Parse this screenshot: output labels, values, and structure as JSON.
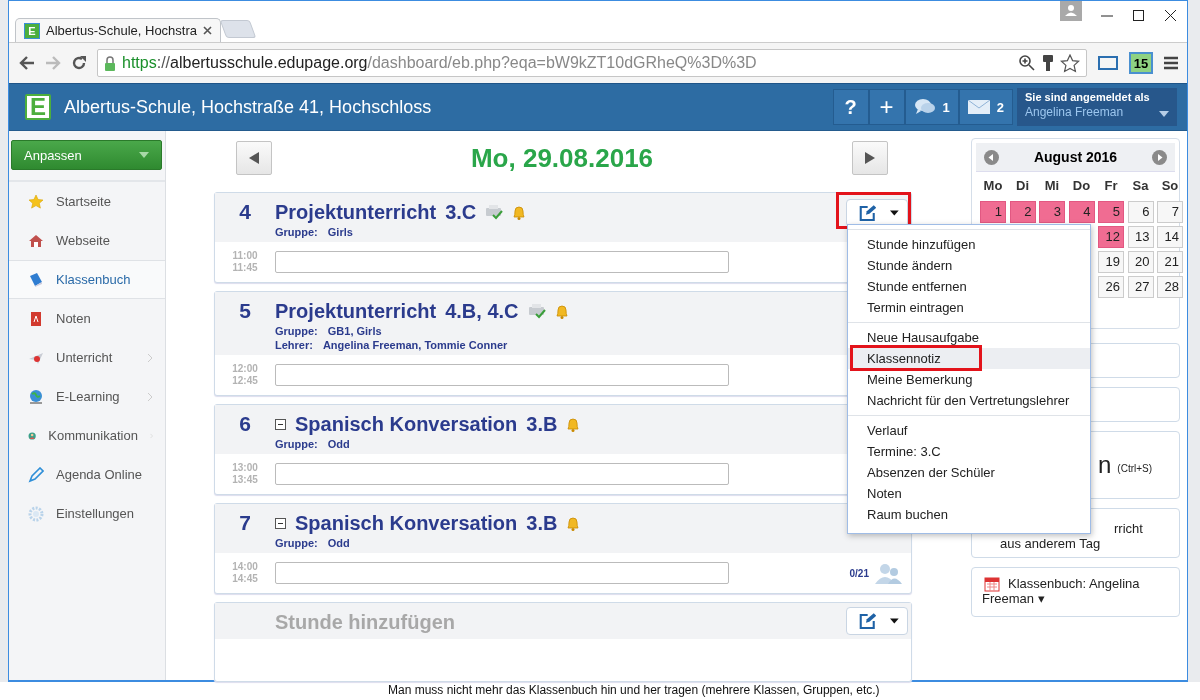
{
  "browser": {
    "tabs": [
      {
        "favicon": "E",
        "title": "Albertus-Schule, Hochstra",
        "selected": true
      }
    ],
    "url": [
      {
        "text": "https",
        "kind": "scheme"
      },
      {
        "text": "://",
        "kind": "sep"
      },
      {
        "text": "albertusschule.edupage.org",
        "kind": "host"
      },
      {
        "text": "/dashboard/eb.php?eqa=bW9kZT10dGRheQ%3D%3D",
        "kind": "path"
      }
    ],
    "extension_badge": "15"
  },
  "header": {
    "logo": "E",
    "school": "Albertus-Schule, Hochstraße 41, Hochschloss",
    "buttons": [
      {
        "kind": "help",
        "label": "?"
      },
      {
        "kind": "add",
        "label": "+"
      },
      {
        "kind": "chat",
        "count": "1"
      },
      {
        "kind": "mail",
        "count": "2"
      }
    ],
    "user": {
      "caption": "Sie sind angemeldet als",
      "name": "Angelina Freeman"
    }
  },
  "sidebar": {
    "button": "Anpassen",
    "items": [
      {
        "label": "Startseite",
        "selected": false,
        "submenu": false
      },
      {
        "label": "Webseite",
        "selected": false,
        "submenu": false
      },
      {
        "label": "Klassenbuch",
        "selected": true,
        "submenu": false
      },
      {
        "label": "Noten",
        "selected": false,
        "submenu": false
      },
      {
        "label": "Unterricht",
        "selected": false,
        "submenu": true
      },
      {
        "label": "E-Learning",
        "selected": false,
        "submenu": true
      },
      {
        "label": "Kommunikation",
        "selected": false,
        "submenu": true
      },
      {
        "label": "Agenda Online",
        "selected": false,
        "submenu": false
      },
      {
        "label": "Einstellungen",
        "selected": false,
        "submenu": false
      }
    ]
  },
  "day": {
    "date": "Mo, 29.08.2016"
  },
  "lessons": [
    {
      "number": "4",
      "subject": "Projektunterricht",
      "class": "3.C",
      "collapsible": false,
      "synced": true,
      "details": [
        {
          "label": "Gruppe:",
          "value": "Girls"
        }
      ],
      "start": "11:00",
      "end": "11:45",
      "edit_button": true,
      "annotated": true
    },
    {
      "number": "5",
      "subject": "Projektunterricht",
      "class": "4.B, 4.C",
      "collapsible": false,
      "synced": true,
      "details": [
        {
          "label": "Gruppe:",
          "value": "GB1, Girls"
        },
        {
          "label": "Lehrer:",
          "value": "Angelina Freeman, Tommie Conner"
        }
      ],
      "start": "12:00",
      "end": "12:45",
      "edit_button": false,
      "annotated": false
    },
    {
      "number": "6",
      "subject": "Spanisch Konversation",
      "class": "3.B",
      "collapsible": true,
      "synced": false,
      "details": [
        {
          "label": "Gruppe:",
          "value": "Odd"
        }
      ],
      "start": "13:00",
      "end": "13:45",
      "edit_button": false,
      "annotated": false
    },
    {
      "number": "7",
      "subject": "Spanisch Konversation",
      "class": "3.B",
      "collapsible": true,
      "synced": false,
      "details": [
        {
          "label": "Gruppe:",
          "value": "Odd"
        }
      ],
      "start": "14:00",
      "end": "14:45",
      "edit_button": false,
      "annotated": false,
      "count": "0/21"
    }
  ],
  "add_lesson": {
    "label": "Stunde hinzufügen"
  },
  "calendar": {
    "title": "August 2016",
    "weekdays": [
      "Mo",
      "Di",
      "Mi",
      "Do",
      "Fr",
      "Sa",
      "So"
    ],
    "weeks": [
      {
        "days": [
          {
            "day": "1",
            "marked": true
          },
          {
            "day": "2",
            "marked": true
          },
          {
            "day": "3",
            "marked": true
          },
          {
            "day": "4",
            "marked": true
          },
          {
            "day": "5",
            "marked": true
          },
          {
            "day": "6",
            "marked": false
          },
          {
            "day": "7",
            "marked": false
          }
        ]
      },
      {
        "days": [
          {
            "day": "12",
            "marked": true
          },
          {
            "day": "13",
            "marked": false
          },
          {
            "day": "14",
            "marked": false
          }
        ]
      },
      {
        "days": [
          {
            "day": "19",
            "marked": false
          },
          {
            "day": "20",
            "marked": false
          },
          {
            "day": "21",
            "marked": false
          }
        ]
      },
      {
        "days": [
          {
            "day": "26",
            "marked": false
          },
          {
            "day": "27",
            "marked": false
          },
          {
            "day": "28",
            "marked": false
          }
        ]
      }
    ]
  },
  "actions": [
    {
      "kind": "blank"
    },
    {
      "kind": "blank"
    },
    {
      "kind": "save",
      "text": "n",
      "hint": "(Ctrl+S)"
    },
    {
      "kind": "copy",
      "text": "rricht aus anderem Tag"
    },
    {
      "kind": "book",
      "text": "Klassenbuch: Angelina Freeman ▾"
    }
  ],
  "menu": {
    "groups": [
      {
        "items": [
          {
            "label": "Stunde hinzufügen",
            "selected": false
          },
          {
            "label": "Stunde ändern",
            "selected": false
          },
          {
            "label": "Stunde entfernen",
            "selected": false
          },
          {
            "label": "Termin eintragen",
            "selected": false
          }
        ]
      },
      {
        "items": [
          {
            "label": "Neue Hausaufgabe",
            "selected": false
          },
          {
            "label": "Klassennotiz",
            "selected": true,
            "annotated": true
          },
          {
            "label": "Meine Bemerkung",
            "selected": false
          },
          {
            "label": "Nachricht für den Vertretungslehrer",
            "selected": false
          }
        ]
      },
      {
        "items": [
          {
            "label": "Verlauf",
            "selected": false
          },
          {
            "label": "Termine: 3.C",
            "selected": false
          },
          {
            "label": "Absenzen der Schüler",
            "selected": false
          },
          {
            "label": "Noten",
            "selected": false
          },
          {
            "label": "Raum buchen",
            "selected": false
          }
        ]
      }
    ]
  },
  "footer_text": "Man muss nicht mehr das Klassenbuch hin und her tragen (mehrere Klassen, Gruppen, etc.)"
}
